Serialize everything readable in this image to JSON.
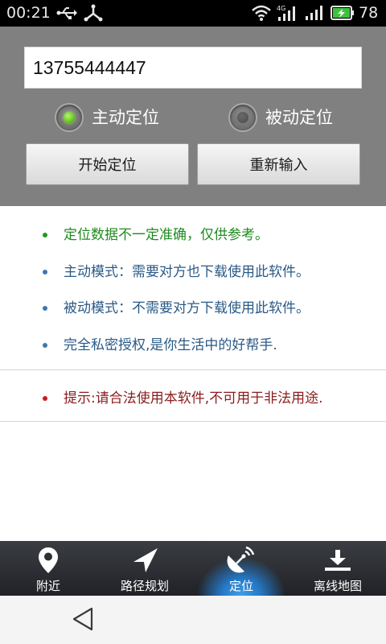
{
  "status_bar": {
    "time": "00:21",
    "battery_level": "78",
    "network_label": "4G",
    "icons": [
      "usb-icon",
      "debug-icon",
      "wifi-icon",
      "signal-4g-icon",
      "signal-icon",
      "battery-icon"
    ]
  },
  "panel": {
    "phone_value": "13755444447",
    "radios": {
      "active_label": "主动定位",
      "passive_label": "被动定位",
      "selected": "active"
    },
    "buttons": {
      "start_label": "开始定位",
      "reset_label": "重新输入"
    }
  },
  "info": {
    "items": [
      "定位数据不一定准确，仅供参考。",
      "主动模式：需要对方也下载使用此软件。",
      "被动模式：不需要对方下载使用此软件。",
      "完全私密授权,是你生活中的好帮手."
    ],
    "notice": "提示:请合法使用本软件,不可用于非法用途."
  },
  "tabs": {
    "items": [
      {
        "label": "附近",
        "icon": "location-pin-icon"
      },
      {
        "label": "路径规划",
        "icon": "navigation-arrow-icon"
      },
      {
        "label": "定位",
        "icon": "satellite-dish-icon"
      },
      {
        "label": "离线地图",
        "icon": "download-icon"
      }
    ],
    "selected_index": 2
  },
  "navbar": {
    "icons": [
      "back-icon"
    ]
  },
  "colors": {
    "panel_bg": "#808080",
    "green_text": "#1f8a1f",
    "blue_text": "#2a5a86",
    "red_text": "#8a1d1d",
    "tab_selected": "#2577c4",
    "radio_on": "#67c81c"
  }
}
